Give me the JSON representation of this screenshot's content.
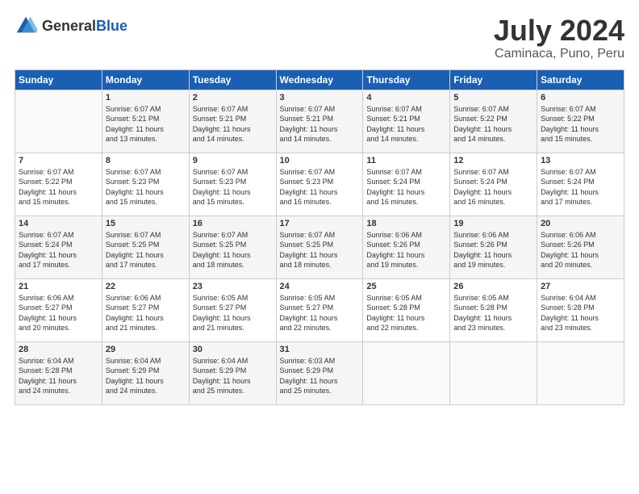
{
  "header": {
    "logo_general": "General",
    "logo_blue": "Blue",
    "title": "July 2024",
    "subtitle": "Caminaca, Puno, Peru"
  },
  "days_of_week": [
    "Sunday",
    "Monday",
    "Tuesday",
    "Wednesday",
    "Thursday",
    "Friday",
    "Saturday"
  ],
  "weeks": [
    [
      {
        "day": "",
        "info": ""
      },
      {
        "day": "1",
        "info": "Sunrise: 6:07 AM\nSunset: 5:21 PM\nDaylight: 11 hours\nand 13 minutes."
      },
      {
        "day": "2",
        "info": "Sunrise: 6:07 AM\nSunset: 5:21 PM\nDaylight: 11 hours\nand 14 minutes."
      },
      {
        "day": "3",
        "info": "Sunrise: 6:07 AM\nSunset: 5:21 PM\nDaylight: 11 hours\nand 14 minutes."
      },
      {
        "day": "4",
        "info": "Sunrise: 6:07 AM\nSunset: 5:21 PM\nDaylight: 11 hours\nand 14 minutes."
      },
      {
        "day": "5",
        "info": "Sunrise: 6:07 AM\nSunset: 5:22 PM\nDaylight: 11 hours\nand 14 minutes."
      },
      {
        "day": "6",
        "info": "Sunrise: 6:07 AM\nSunset: 5:22 PM\nDaylight: 11 hours\nand 15 minutes."
      }
    ],
    [
      {
        "day": "7",
        "info": "Sunrise: 6:07 AM\nSunset: 5:22 PM\nDaylight: 11 hours\nand 15 minutes."
      },
      {
        "day": "8",
        "info": "Sunrise: 6:07 AM\nSunset: 5:23 PM\nDaylight: 11 hours\nand 15 minutes."
      },
      {
        "day": "9",
        "info": "Sunrise: 6:07 AM\nSunset: 5:23 PM\nDaylight: 11 hours\nand 15 minutes."
      },
      {
        "day": "10",
        "info": "Sunrise: 6:07 AM\nSunset: 5:23 PM\nDaylight: 11 hours\nand 16 minutes."
      },
      {
        "day": "11",
        "info": "Sunrise: 6:07 AM\nSunset: 5:24 PM\nDaylight: 11 hours\nand 16 minutes."
      },
      {
        "day": "12",
        "info": "Sunrise: 6:07 AM\nSunset: 5:24 PM\nDaylight: 11 hours\nand 16 minutes."
      },
      {
        "day": "13",
        "info": "Sunrise: 6:07 AM\nSunset: 5:24 PM\nDaylight: 11 hours\nand 17 minutes."
      }
    ],
    [
      {
        "day": "14",
        "info": "Sunrise: 6:07 AM\nSunset: 5:24 PM\nDaylight: 11 hours\nand 17 minutes."
      },
      {
        "day": "15",
        "info": "Sunrise: 6:07 AM\nSunset: 5:25 PM\nDaylight: 11 hours\nand 17 minutes."
      },
      {
        "day": "16",
        "info": "Sunrise: 6:07 AM\nSunset: 5:25 PM\nDaylight: 11 hours\nand 18 minutes."
      },
      {
        "day": "17",
        "info": "Sunrise: 6:07 AM\nSunset: 5:25 PM\nDaylight: 11 hours\nand 18 minutes."
      },
      {
        "day": "18",
        "info": "Sunrise: 6:06 AM\nSunset: 5:26 PM\nDaylight: 11 hours\nand 19 minutes."
      },
      {
        "day": "19",
        "info": "Sunrise: 6:06 AM\nSunset: 5:26 PM\nDaylight: 11 hours\nand 19 minutes."
      },
      {
        "day": "20",
        "info": "Sunrise: 6:06 AM\nSunset: 5:26 PM\nDaylight: 11 hours\nand 20 minutes."
      }
    ],
    [
      {
        "day": "21",
        "info": "Sunrise: 6:06 AM\nSunset: 5:27 PM\nDaylight: 11 hours\nand 20 minutes."
      },
      {
        "day": "22",
        "info": "Sunrise: 6:06 AM\nSunset: 5:27 PM\nDaylight: 11 hours\nand 21 minutes."
      },
      {
        "day": "23",
        "info": "Sunrise: 6:05 AM\nSunset: 5:27 PM\nDaylight: 11 hours\nand 21 minutes."
      },
      {
        "day": "24",
        "info": "Sunrise: 6:05 AM\nSunset: 5:27 PM\nDaylight: 11 hours\nand 22 minutes."
      },
      {
        "day": "25",
        "info": "Sunrise: 6:05 AM\nSunset: 5:28 PM\nDaylight: 11 hours\nand 22 minutes."
      },
      {
        "day": "26",
        "info": "Sunrise: 6:05 AM\nSunset: 5:28 PM\nDaylight: 11 hours\nand 23 minutes."
      },
      {
        "day": "27",
        "info": "Sunrise: 6:04 AM\nSunset: 5:28 PM\nDaylight: 11 hours\nand 23 minutes."
      }
    ],
    [
      {
        "day": "28",
        "info": "Sunrise: 6:04 AM\nSunset: 5:28 PM\nDaylight: 11 hours\nand 24 minutes."
      },
      {
        "day": "29",
        "info": "Sunrise: 6:04 AM\nSunset: 5:29 PM\nDaylight: 11 hours\nand 24 minutes."
      },
      {
        "day": "30",
        "info": "Sunrise: 6:04 AM\nSunset: 5:29 PM\nDaylight: 11 hours\nand 25 minutes."
      },
      {
        "day": "31",
        "info": "Sunrise: 6:03 AM\nSunset: 5:29 PM\nDaylight: 11 hours\nand 25 minutes."
      },
      {
        "day": "",
        "info": ""
      },
      {
        "day": "",
        "info": ""
      },
      {
        "day": "",
        "info": ""
      }
    ]
  ]
}
